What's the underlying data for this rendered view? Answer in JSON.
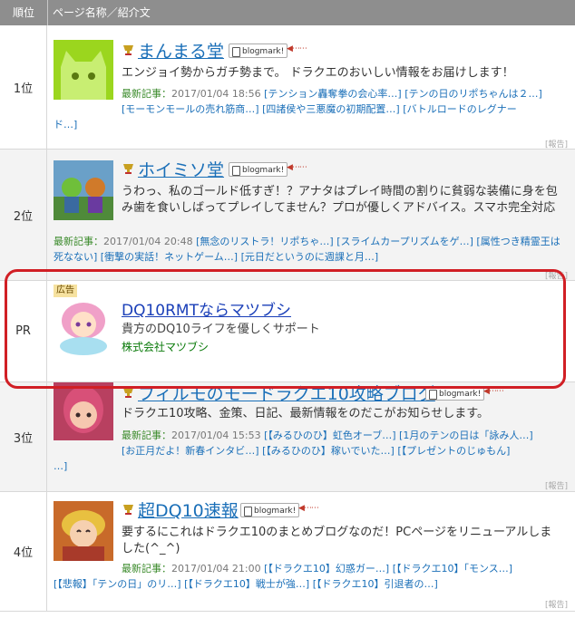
{
  "header": {
    "rank_col": "順位",
    "name_col": "ページ名称／紹介文"
  },
  "entries": [
    {
      "rank": "1位",
      "title": "まんまる堂",
      "bookmark": "blogmark!",
      "desc": "エンジョイ勢からガチ勢まで。 ドラクエのおいしい情報をお届けします！",
      "recent_label": "最新記事：",
      "recent_date": "2017/01/04 18:56",
      "recent": [
        "[テンション轟奪拳の会心率…]",
        "[テンの日のリポちゃんは２…]",
        "[モーモンモールの売れ筋商…]",
        "[四諸侯や三悪魔の初期配置…]",
        "[バトルロードのレグナー",
        "ド…]"
      ],
      "report": "[報告]"
    },
    {
      "rank": "2位",
      "title": "ホイミソ堂",
      "bookmark": "blogmark!",
      "desc": "うわっ、私のゴールド低すぎ！？アナタはプレイ時間の割りに貧弱な装備に身を包み歯を食いしばってプレイしてません？プロが優しくアドバイス。スマホ完全対応",
      "recent_label": "最新記事：",
      "recent_date": "2017/01/04 20:48",
      "recent": [
        "[無念のリストラ！リポちゃ…]",
        "[スライムカープリズムをゲ…]",
        "[属性つき精霊王は死なない]",
        "[衝撃の実話！ネットゲーム…]",
        "[元日だというのに週課と月…]"
      ],
      "report": "[報告]"
    },
    {
      "rank": "3位",
      "title": "フィルモのモードラクエ10攻略ブログ",
      "bookmark": "blogmark!",
      "desc": "ドラクエ10攻略、金策、日記、最新情報をのだこがお知らせします。",
      "recent_label": "最新記事：",
      "recent_date": "2017/01/04 15:53",
      "recent": [
        "[【みるひのひ】虹色オーブ…]",
        "[1月のテンの日は「詠み人…]",
        "[お正月だよ！新春インタビ…]",
        "[【みるひのひ】稼いでいた…]",
        "[【プレゼントのじゅもん]",
        "…]"
      ],
      "report": "[報告]"
    },
    {
      "rank": "4位",
      "title": "超DQ10速報",
      "bookmark": "blogmark!",
      "desc": "要するにこれはドラクエ10のまとめブログなのだ！PCページをリニューアルしました(^_^)",
      "recent_label": "最新記事：",
      "recent_date": "2017/01/04 21:00",
      "recent": [
        "[【ドラクエ10】幻惑ガー…]",
        "[【ドラクエ10】「モンス…]",
        "[【悲報】「テンの日」のリ…]",
        "[【ドラクエ10】戦士が強…]",
        "[【ドラクエ10】引退者の…]"
      ],
      "report": "[報告]"
    }
  ],
  "ad": {
    "rank": "PR",
    "badge": "広告",
    "title": "DQ10RMTならマツブシ",
    "desc": "貴方のDQ10ライフを優しくサポート",
    "company": "株式会社マツブシ"
  },
  "colors": {
    "title_link": "#1a6fb8",
    "highlight": "#d11f25",
    "header_bg": "#8e8e8e"
  }
}
